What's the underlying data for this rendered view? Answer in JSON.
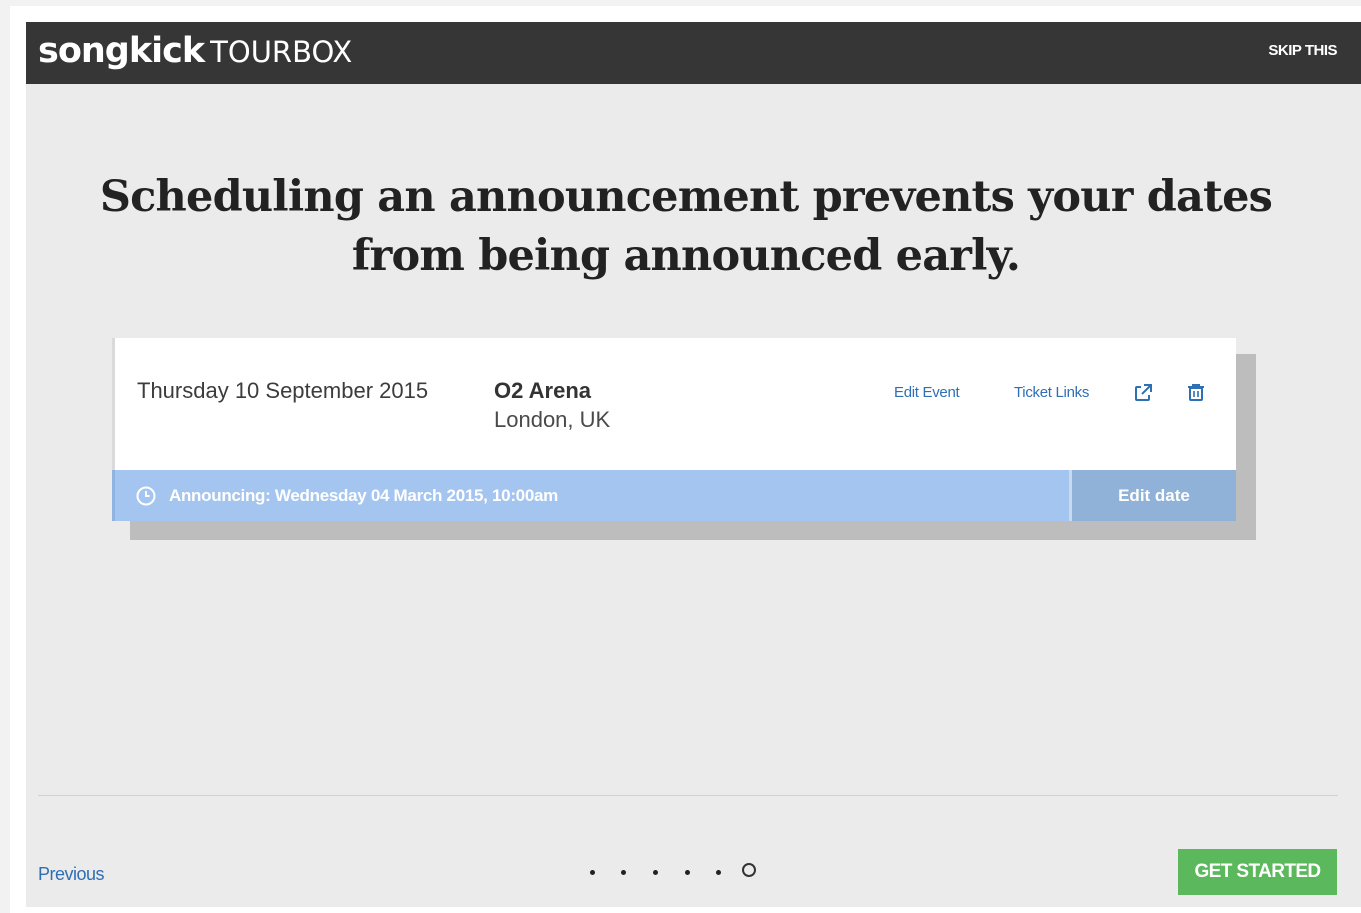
{
  "header": {
    "brand": "songkick",
    "product": "TOURBOX",
    "skip_label": "SKIP THIS"
  },
  "headline": "Scheduling an announcement prevents your dates from being announced early.",
  "event": {
    "date": "Thursday 10 September 2015",
    "venue": "O2 Arena",
    "location": "London, UK",
    "actions": {
      "edit_event": "Edit Event",
      "ticket_links": "Ticket Links",
      "external_icon": "external-link-icon",
      "delete_icon": "trash-icon"
    },
    "announcement": {
      "icon": "clock-icon",
      "text": "Announcing: Wednesday 04 March 2015, 10:00am",
      "edit_label": "Edit date"
    }
  },
  "footer": {
    "previous_label": "Previous",
    "pager": {
      "total": 6,
      "current": 6
    },
    "cta_label": "GET STARTED"
  },
  "colors": {
    "topbar": "#363636",
    "background": "#ebebeb",
    "link": "#2f6fb4",
    "announce_bar": "#a4c5ef",
    "edit_date": "#90b1d8",
    "cta": "#5cb85c"
  }
}
